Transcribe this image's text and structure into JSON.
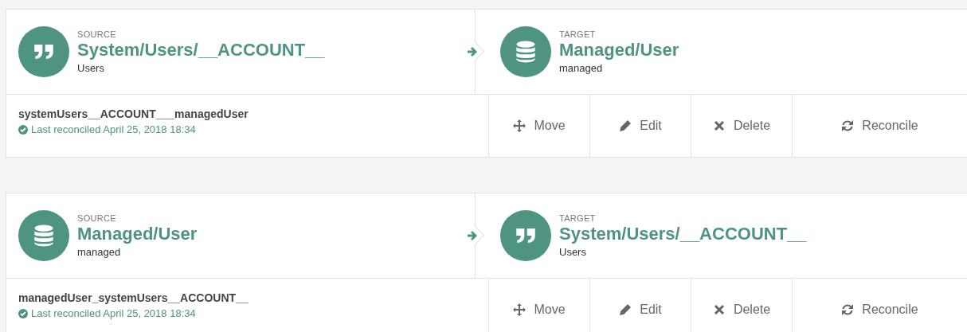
{
  "mappings": [
    {
      "source": {
        "label": "SOURCE",
        "kind": "quote",
        "title": "System/Users/__ACCOUNT__",
        "subtitle": "Users"
      },
      "target": {
        "label": "TARGET",
        "kind": "database",
        "title": "Managed/User",
        "subtitle": "managed"
      },
      "name": "systemUsers__ACCOUNT___managedUser",
      "status": "Last reconciled April 25, 2018 18:34",
      "actions": [
        {
          "kind": "move",
          "label": "Move"
        },
        {
          "kind": "edit",
          "label": "Edit"
        },
        {
          "kind": "delete",
          "label": "Delete"
        },
        {
          "kind": "reconcile",
          "label": "Reconcile"
        }
      ]
    },
    {
      "source": {
        "label": "SOURCE",
        "kind": "database",
        "title": "Managed/User",
        "subtitle": "managed"
      },
      "target": {
        "label": "TARGET",
        "kind": "quote",
        "title": "System/Users/__ACCOUNT__",
        "subtitle": "Users"
      },
      "name": "managedUser_systemUsers__ACCOUNT__",
      "status": "Last reconciled April 25, 2018 18:34",
      "actions": [
        {
          "kind": "move",
          "label": "Move"
        },
        {
          "kind": "edit",
          "label": "Edit"
        },
        {
          "kind": "delete",
          "label": "Delete"
        },
        {
          "kind": "reconcile",
          "label": "Reconcile"
        }
      ]
    }
  ]
}
